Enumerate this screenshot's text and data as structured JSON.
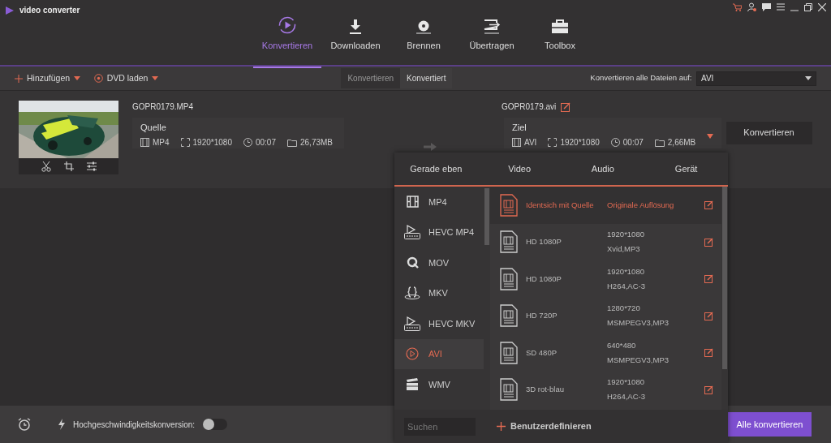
{
  "app": {
    "title": "video converter"
  },
  "nav_tabs": [
    {
      "label": "Konvertieren",
      "kind": "convert",
      "selected": true
    },
    {
      "label": "Downloaden",
      "kind": "download",
      "selected": false
    },
    {
      "label": "Brennen",
      "kind": "burn",
      "selected": false
    },
    {
      "label": "Übertragen",
      "kind": "transfer",
      "selected": false
    },
    {
      "label": "Toolbox",
      "kind": "toolbox",
      "selected": false
    }
  ],
  "toolbar": {
    "add": "Hinzufügen",
    "dvd": "DVD laden",
    "segments": [
      {
        "label": "Konvertieren",
        "selected": true
      },
      {
        "label": "Konvertiert",
        "selected": false
      }
    ],
    "target_label": "Konvertieren alle Dateien auf:",
    "target_value": "AVI"
  },
  "file": {
    "source_name": "GOPR0179.MP4",
    "source": {
      "label": "Quelle",
      "format": "MP4",
      "resolution": "1920*1080",
      "duration": "00:07",
      "size": "26,73MB"
    },
    "target_name": "GOPR0179.avi",
    "target": {
      "label": "Ziel",
      "format": "AVI",
      "resolution": "1920*1080",
      "duration": "00:07",
      "size": "2,66MB"
    },
    "convert_button": "Konvertieren"
  },
  "format_panel": {
    "tabs": [
      "Gerade eben",
      "Video",
      "Audio",
      "Gerät"
    ],
    "formats": [
      {
        "label": "MP4",
        "kind": "film",
        "selected": false
      },
      {
        "label": "HEVC MP4",
        "kind": "hevc",
        "selected": false
      },
      {
        "label": "MOV",
        "kind": "q",
        "selected": false
      },
      {
        "label": "MKV",
        "kind": "braces",
        "selected": false
      },
      {
        "label": "HEVC MKV",
        "kind": "hevc",
        "selected": false
      },
      {
        "label": "AVI",
        "kind": "play",
        "selected": true
      },
      {
        "label": "WMV",
        "kind": "clapper",
        "selected": false
      }
    ],
    "presets": [
      {
        "name": "Identsich mit Quelle",
        "details": [
          "Originale Auflösung"
        ],
        "selected": true
      },
      {
        "name": "HD 1080P",
        "details": [
          "1920*1080",
          "Xvid,MP3"
        ],
        "selected": false
      },
      {
        "name": "HD 1080P",
        "details": [
          "1920*1080",
          "H264,AC-3"
        ],
        "selected": false
      },
      {
        "name": "HD 720P",
        "details": [
          "1280*720",
          "MSMPEGV3,MP3"
        ],
        "selected": false
      },
      {
        "name": "SD 480P",
        "details": [
          "640*480",
          "MSMPEGV3,MP3"
        ],
        "selected": false
      },
      {
        "name": "3D rot-blau",
        "details": [
          "1920*1080",
          "H264,AC-3"
        ],
        "selected": false
      }
    ],
    "search": {
      "placeholder": "Suchen"
    },
    "custom": "Benutzerdefinieren"
  },
  "bottom": {
    "speed_label": "Hochgeschwindigkeitskonversion:",
    "speed_on": false,
    "convert_all": "Alle konvertieren"
  }
}
